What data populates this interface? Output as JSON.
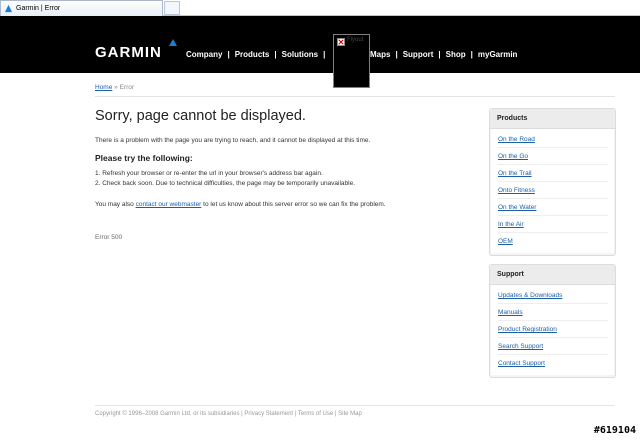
{
  "browser": {
    "tab_title": "Garmin | Error"
  },
  "header": {
    "logo": "GARMIN",
    "nav_left": [
      "Company",
      "Products",
      "Solutions"
    ],
    "nav_right": [
      "Maps",
      "Support",
      "Shop",
      "myGarmin"
    ],
    "broken_image_label": "Flyout"
  },
  "breadcrumb": {
    "home": "Home",
    "separator": "»",
    "current": "Error"
  },
  "main": {
    "title": "Sorry, page cannot be displayed.",
    "intro": "There is a problem with the page you are trying to reach, and it cannot be displayed at this time.",
    "subhead": "Please try the following:",
    "steps": [
      "1.  Refresh your browser or re-enter the url in your browser's address bar again.",
      "2.  Check back soon. Due to technical difficulties, the page may be temporarily unavailable."
    ],
    "contact_prefix": "You may also ",
    "contact_link": "contact our webmaster",
    "contact_suffix": " to let us know about this server error so we can fix the problem.",
    "error_code": "Error 500"
  },
  "sidebar": {
    "products": {
      "title": "Products",
      "links": [
        "On the Road",
        "On the Go",
        "On the Trail",
        "Onto Fitness",
        "On the Water",
        "In the Air",
        "OEM"
      ]
    },
    "support": {
      "title": "Support",
      "links": [
        "Updates & Downloads",
        "Manuals",
        "Product Registration",
        "Search Support",
        "Contact Support"
      ]
    }
  },
  "footer": {
    "copyright": "Copyright © 1996–2008 Garmin Ltd. or its subsidiaries",
    "links": [
      "Privacy Statement",
      "Terms of Use",
      "Site Map"
    ]
  },
  "watermark": "#619104",
  "colors": {
    "header_bg": "#000000",
    "link": "#1a5fa8",
    "logo_accent": "#1a7fd4"
  }
}
